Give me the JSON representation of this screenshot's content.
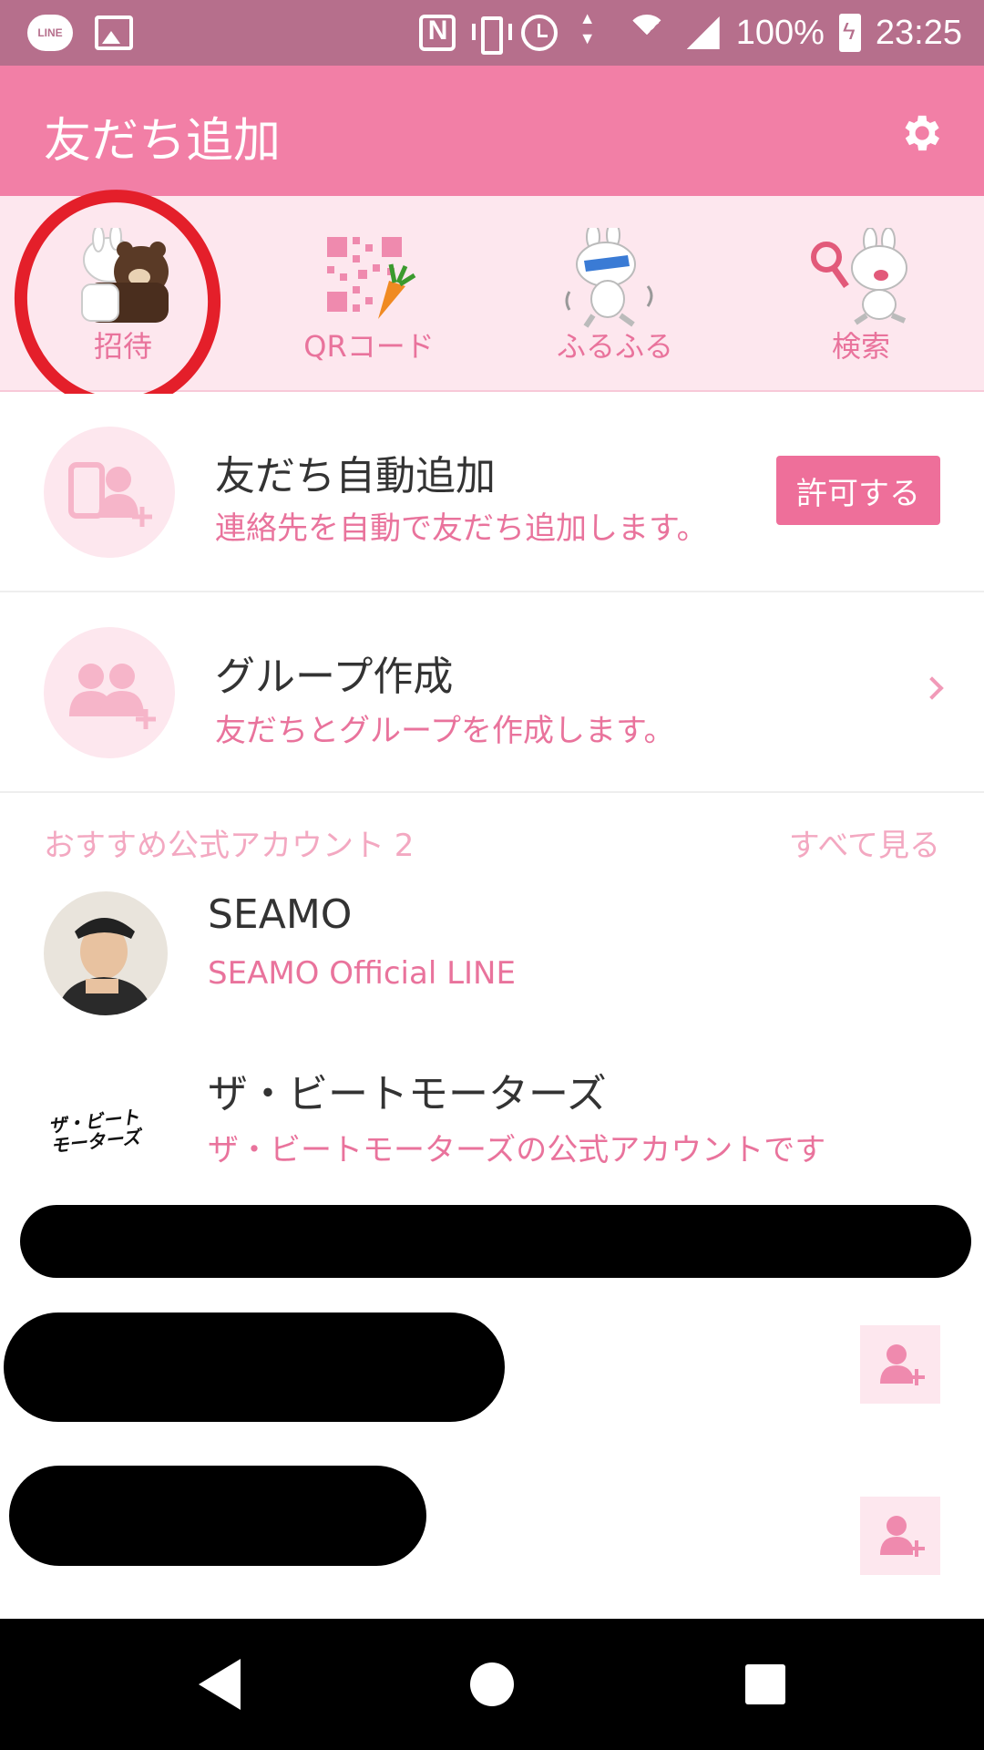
{
  "status_bar": {
    "line_badge": "LINE",
    "battery": "100%",
    "time": "23:25"
  },
  "header": {
    "title": "友だち追加"
  },
  "tabs": [
    {
      "label": "招待",
      "icon": "invite-bears-icon"
    },
    {
      "label": "QRコード",
      "icon": "qr-carrot-icon"
    },
    {
      "label": "ふるふる",
      "icon": "shake-bunny-icon"
    },
    {
      "label": "検索",
      "icon": "search-bunny-icon"
    }
  ],
  "auto_add": {
    "title": "友だち自動追加",
    "subtitle": "連絡先を自動で友だち追加します。",
    "button": "許可する"
  },
  "group": {
    "title": "グループ作成",
    "subtitle": "友だちとグループを作成します。"
  },
  "recommended": {
    "heading": "おすすめ公式アカウント 2",
    "see_all": "すべて見る",
    "accounts": [
      {
        "name": "SEAMO",
        "description": "SEAMO Official LINE"
      },
      {
        "name": "ザ・ビートモーターズ",
        "description": "ザ・ビートモーターズの公式アカウントです",
        "logo_text": "ザ・ビート モーターズ"
      }
    ]
  },
  "colors": {
    "accent": "#f27fa6",
    "status_bar": "#b66f8c",
    "tab_bg": "#fde7ee",
    "label_pink": "#e9739c",
    "annotation_red": "#e41f2a"
  }
}
